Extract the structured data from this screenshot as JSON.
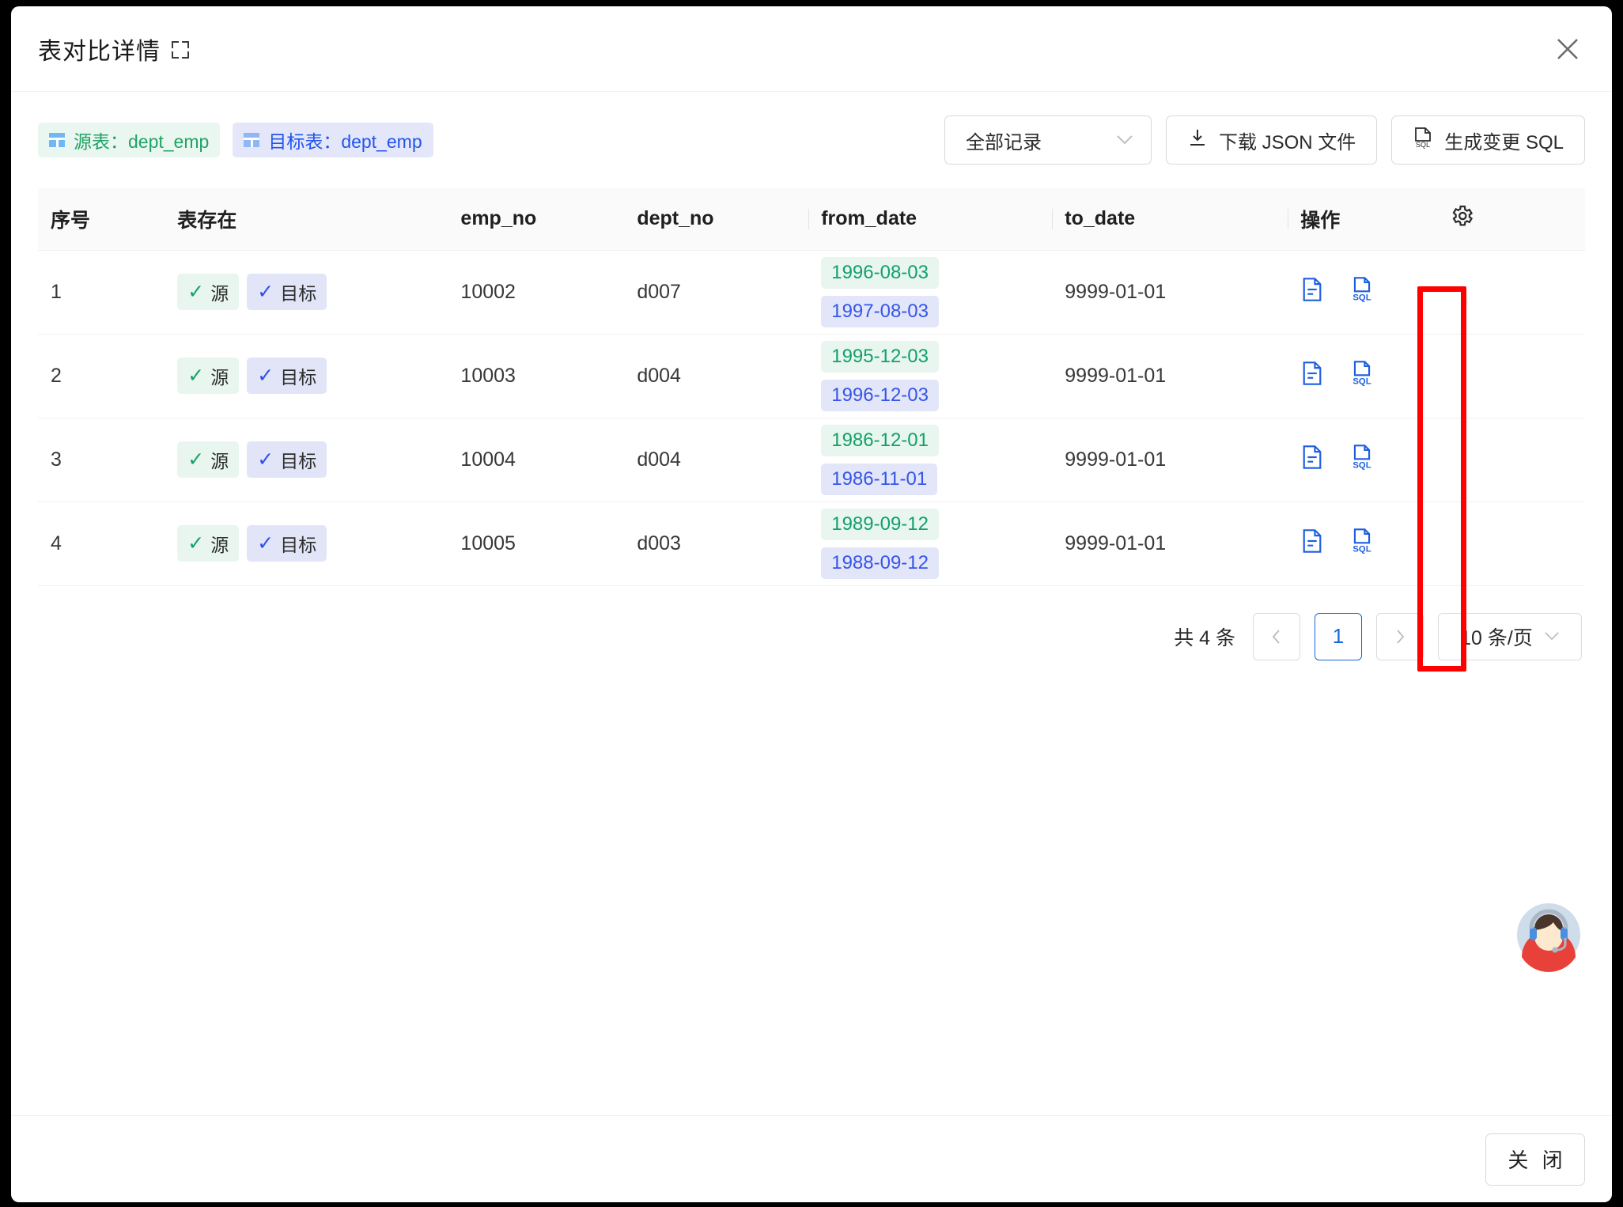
{
  "dialog": {
    "title": "表对比详情",
    "expand_icon": "expand-corners-icon",
    "close_icon": "close-icon",
    "footer_close_label": "关 闭"
  },
  "toolbar": {
    "chips": [
      {
        "icon": "table-icon",
        "label": "源表：dept_emp",
        "variant": "source"
      },
      {
        "icon": "table-icon",
        "label": "目标表：dept_emp",
        "variant": "target"
      }
    ],
    "record_filter": {
      "value": "全部记录",
      "caret_icon": "chevron-down-icon"
    },
    "download_json": {
      "label": "下载 JSON 文件",
      "icon": "download-icon"
    },
    "generate_sql": {
      "label": "生成变更 SQL",
      "icon": "sql-file-icon"
    }
  },
  "table": {
    "columns": [
      {
        "key": "index",
        "label": "序号"
      },
      {
        "key": "exists",
        "label": "表存在"
      },
      {
        "key": "emp_no",
        "label": "emp_no"
      },
      {
        "key": "dept_no",
        "label": "dept_no"
      },
      {
        "key": "from_date",
        "label": "from_date"
      },
      {
        "key": "to_date",
        "label": "to_date"
      },
      {
        "key": "action",
        "label": "操作"
      }
    ],
    "settings_icon": "gear-icon",
    "exists_tags": {
      "source_label": "源",
      "target_label": "目标",
      "check_icon": "check-icon"
    },
    "row_action_icons": [
      {
        "name": "detail-document-icon",
        "label": "详情"
      },
      {
        "name": "sql-file-icon",
        "label": "SQL",
        "highlighted": true
      }
    ],
    "rows": [
      {
        "index": "1",
        "exists": {
          "source": "源",
          "target": "目标"
        },
        "emp_no": "10002",
        "dept_no": "d007",
        "from_date_source": "1996-08-03",
        "from_date_target": "1997-08-03",
        "to_date": "9999-01-01"
      },
      {
        "index": "2",
        "exists": {
          "source": "源",
          "target": "目标"
        },
        "emp_no": "10003",
        "dept_no": "d004",
        "from_date_source": "1995-12-03",
        "from_date_target": "1996-12-03",
        "to_date": "9999-01-01"
      },
      {
        "index": "3",
        "exists": {
          "source": "源",
          "target": "目标"
        },
        "emp_no": "10004",
        "dept_no": "d004",
        "from_date_source": "1986-12-01",
        "from_date_target": "1986-11-01",
        "to_date": "9999-01-01"
      },
      {
        "index": "4",
        "exists": {
          "source": "源",
          "target": "目标"
        },
        "emp_no": "10005",
        "dept_no": "d003",
        "from_date_source": "1989-09-12",
        "from_date_target": "1988-09-12",
        "to_date": "9999-01-01"
      }
    ]
  },
  "pagination": {
    "total_label": "共 4 条",
    "prev_label": "‹",
    "next_label": "›",
    "current_page": "1",
    "page_size_label": "10 条/页",
    "page_size_caret": "chevron-down-icon"
  },
  "overlays": {
    "highlight_color": "#ff0000",
    "highlight_target": "sql-action-column",
    "support_avatar": "customer-service-avatar-icon"
  },
  "colors": {
    "source_accent": "#21a366",
    "target_accent": "#2255ee",
    "action_icon": "#1e5fe0",
    "page_active": "#1668dc"
  }
}
